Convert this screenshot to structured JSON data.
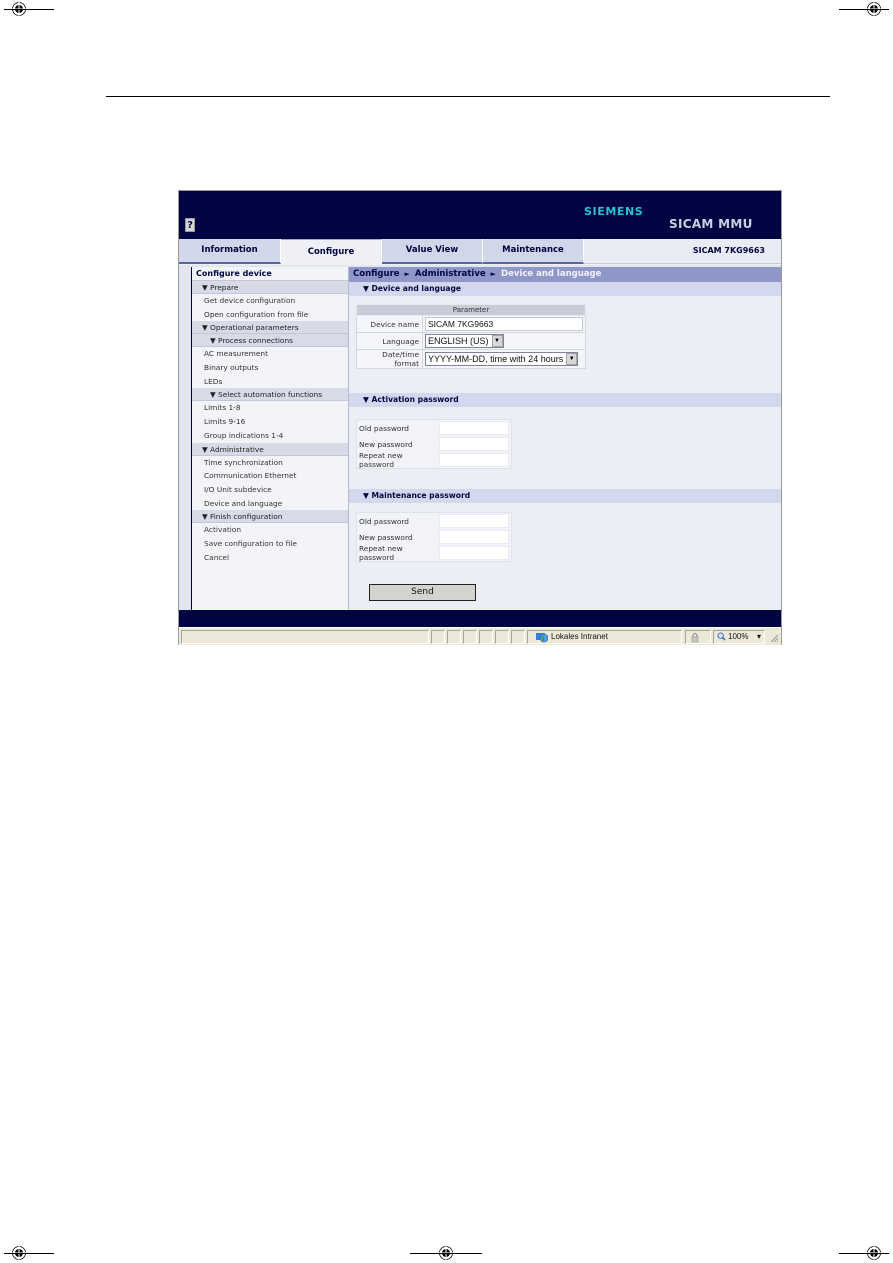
{
  "app": {
    "brand": "SIEMENS",
    "product": "SICAM MMU",
    "device_id": "SICAM 7KG9663",
    "help_icon": "?",
    "colors": {
      "banner": "#000541",
      "brand": "#2cc0d4",
      "breadcrumb_bg": "#8e97c8",
      "section_bg": "#d4d8ee"
    }
  },
  "tabs": [
    {
      "label": "Information",
      "active": false
    },
    {
      "label": "Configure",
      "active": true
    },
    {
      "label": "Value View",
      "active": false
    },
    {
      "label": "Maintenance",
      "active": false
    }
  ],
  "sidebar": {
    "title": "Configure device",
    "entries": [
      {
        "type": "group",
        "label": "▼ Prepare"
      },
      {
        "type": "item",
        "label": "Get device configuration"
      },
      {
        "type": "item",
        "label": "Open configuration from file"
      },
      {
        "type": "group",
        "label": "▼ Operational parameters"
      },
      {
        "type": "group2",
        "label": "▼ Process connections"
      },
      {
        "type": "item",
        "label": "AC measurement"
      },
      {
        "type": "item",
        "label": "Binary outputs"
      },
      {
        "type": "item",
        "label": "LEDs"
      },
      {
        "type": "group2",
        "label": "▼ Select automation functions"
      },
      {
        "type": "item",
        "label": "Limits 1-8"
      },
      {
        "type": "item",
        "label": "Limits 9-16"
      },
      {
        "type": "item",
        "label": "Group indications 1-4"
      },
      {
        "type": "group",
        "label": "▼ Administrative"
      },
      {
        "type": "item",
        "label": "Time synchronization"
      },
      {
        "type": "item",
        "label": "Communication Ethernet"
      },
      {
        "type": "item",
        "label": "I/O Unit subdevice"
      },
      {
        "type": "item",
        "label": "Device and language"
      },
      {
        "type": "group",
        "label": "▼ Finish configuration"
      },
      {
        "type": "item",
        "label": "Activation"
      },
      {
        "type": "item",
        "label": "Save configuration to file"
      },
      {
        "type": "item",
        "label": "Cancel"
      }
    ]
  },
  "breadcrumb": {
    "items": [
      "Configure",
      "Administrative"
    ],
    "current": "Device and language",
    "separator": "►"
  },
  "device_section": {
    "title": "▼ Device and language",
    "table_header": "Parameter",
    "device_name_label": "Device name",
    "device_name_value": "SICAM 7KG9663",
    "language_label": "Language",
    "language_value": "ENGLISH (US)",
    "datetime_label": "Date/time format",
    "datetime_value": "YYYY-MM-DD, time with 24 hours",
    "dropdown_arrow": "▼"
  },
  "activation_section": {
    "title": "▼ Activation password",
    "old_label": "Old password",
    "new_label": "New password",
    "repeat_label": "Repeat new password",
    "old_value": "",
    "new_value": "",
    "repeat_value": ""
  },
  "maintenance_section": {
    "title": "▼ Maintenance password",
    "old_label": "Old password",
    "new_label": "New password",
    "repeat_label": "Repeat new password",
    "old_value": "",
    "new_value": "",
    "repeat_value": ""
  },
  "send_label": "Send",
  "statusbar": {
    "zone": "Lokales Intranet",
    "zoom": "100%",
    "zoom_arrow": "▾"
  }
}
